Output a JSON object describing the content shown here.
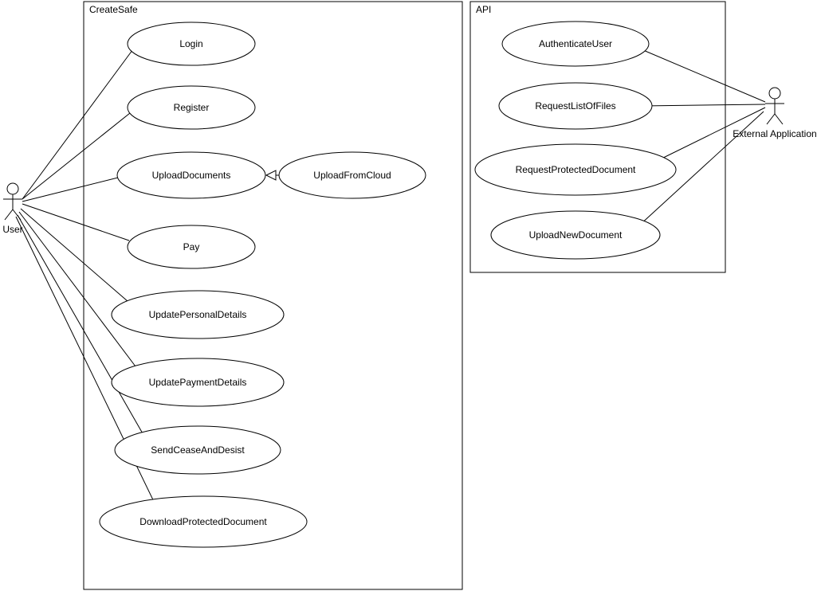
{
  "diagram": {
    "type": "uml-use-case",
    "systems": [
      {
        "id": "createsafe",
        "name": "CreateSafe"
      },
      {
        "id": "api",
        "name": "API"
      }
    ],
    "actors": [
      {
        "id": "user",
        "name": "User"
      },
      {
        "id": "extapp",
        "name": "External Application"
      }
    ],
    "usecases": {
      "login": "Login",
      "register": "Register",
      "uploaddocs": "UploadDocuments",
      "uploadcloud": "UploadFromCloud",
      "pay": "Pay",
      "updatepersonal": "UpdatePersonalDetails",
      "updatepayment": "UpdatePaymentDetails",
      "sendcease": "SendCeaseAndDesist",
      "downloadprot": "DownloadProtectedDocument",
      "authuser": "AuthenticateUser",
      "reqlist": "RequestListOfFiles",
      "reqprot": "RequestProtectedDocument",
      "uploadnew": "UploadNewDocument"
    },
    "associations": [
      [
        "user",
        "login"
      ],
      [
        "user",
        "register"
      ],
      [
        "user",
        "uploaddocs"
      ],
      [
        "user",
        "pay"
      ],
      [
        "user",
        "updatepersonal"
      ],
      [
        "user",
        "updatepayment"
      ],
      [
        "user",
        "sendcease"
      ],
      [
        "user",
        "downloadprot"
      ],
      [
        "extapp",
        "authuser"
      ],
      [
        "extapp",
        "reqlist"
      ],
      [
        "extapp",
        "reqprot"
      ],
      [
        "extapp",
        "uploadnew"
      ]
    ],
    "generalizations": [
      [
        "uploadcloud",
        "uploaddocs"
      ]
    ]
  }
}
